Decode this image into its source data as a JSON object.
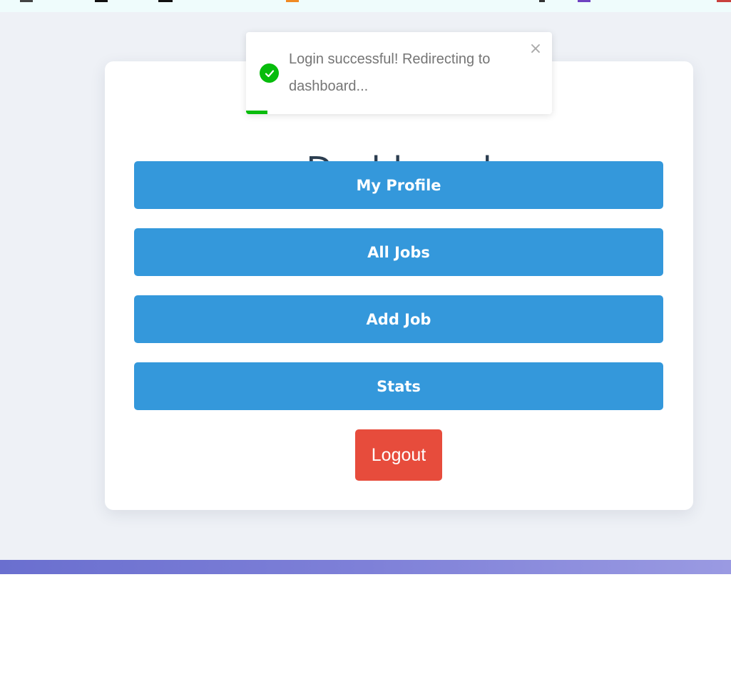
{
  "dashboard": {
    "title": "Dashboard",
    "buttons": [
      {
        "label": "My Profile"
      },
      {
        "label": "All Jobs"
      },
      {
        "label": "Add Job"
      },
      {
        "label": "Stats"
      }
    ],
    "logout_label": "Logout"
  },
  "toast": {
    "message": "Login successful! Redirecting to dashboard...",
    "close_glyph": "×",
    "icon": "check-circle-icon",
    "progress": 0.07
  },
  "colors": {
    "primary_button": "#3498db",
    "logout_button": "#e74c3c",
    "success": "#07bc0c",
    "title_text": "#2c3e50",
    "page_background": "#eef1f6"
  }
}
